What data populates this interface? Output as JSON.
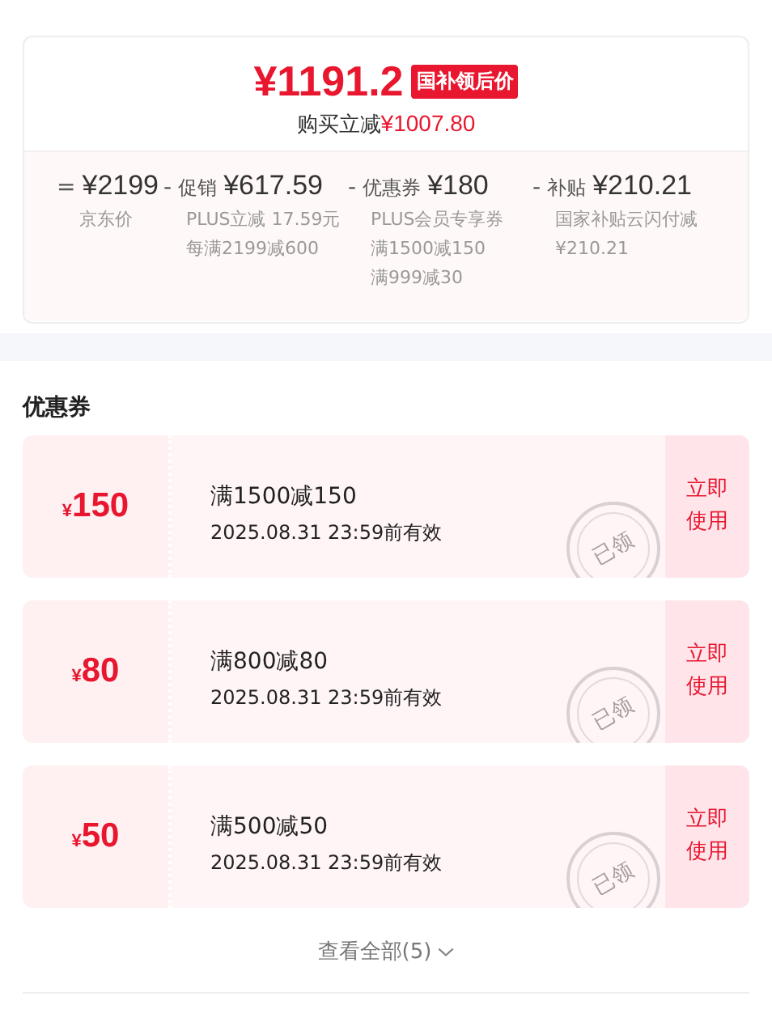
{
  "price_card": {
    "final_price": "¥1191.2",
    "price_tag": "国补领后价",
    "saving_label": "购买立减",
    "saving_amount": "¥1007.80",
    "breakdown": [
      {
        "operator": "=",
        "amount": "¥2199",
        "notes": [
          "京东价"
        ]
      },
      {
        "operator": "-",
        "label": "促销",
        "amount": "¥617.59",
        "notes": [
          "PLUS立减 17.59元",
          "每满2199减600"
        ]
      },
      {
        "operator": "-",
        "label": "优惠券",
        "amount": "¥180",
        "notes": [
          "PLUS会员专享券",
          "满1500减150",
          "满999减30"
        ]
      },
      {
        "operator": "-",
        "label": "补贴",
        "amount": "¥210.21",
        "notes": [
          "国家补贴云闪付减",
          "¥210.21"
        ]
      }
    ]
  },
  "coupons": {
    "title": "优惠券",
    "items": [
      {
        "currency": "¥",
        "value": "150",
        "rule": "满1500减150",
        "expiry": "2025.08.31 23:59前有效",
        "claimed": true,
        "stamp": "已领",
        "action": "立即使用"
      },
      {
        "currency": "¥",
        "value": "80",
        "rule": "满800减80",
        "expiry": "2025.08.31 23:59前有效",
        "claimed": true,
        "stamp": "已领",
        "action": "立即使用"
      },
      {
        "currency": "¥",
        "value": "50",
        "rule": "满500减50",
        "expiry": "2025.08.31 23:59前有效",
        "claimed": true,
        "stamp": "已领",
        "action": "立即使用"
      }
    ],
    "view_all": "查看全部(5)"
  }
}
